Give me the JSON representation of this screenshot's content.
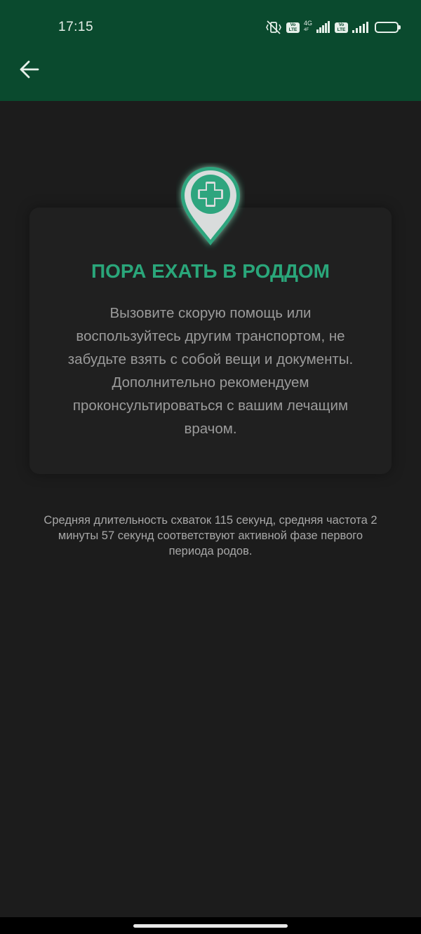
{
  "status_bar": {
    "time": "17:15",
    "network_type": "4G",
    "network_sub": "4F",
    "volte_label_top": "Vo",
    "volte_label_bottom": "LTE",
    "battery_level": "94",
    "battery_fraction": 0.94
  },
  "app_bar": {
    "back_icon": "arrow-left-icon"
  },
  "card": {
    "icon": "map-pin-medical-cross-icon",
    "title": "ПОРА ЕХАТЬ В РОДДОМ",
    "body": "Вызовите скорую помощь или воспользуйтесь другим транспортом, не забудьте взять с собой вещи и документы. Дополнительно рекомендуем проконсультироваться с вашим лечащим врачом."
  },
  "summary": "Средняя длительность схваток 115 секунд, средняя частота 2 минуты 57 секунд соответствуют активной фазе первого периода родов.",
  "colors": {
    "header_green": "#0a4a2e",
    "accent_green": "#2aa67a",
    "background": "#1c1c1c"
  }
}
